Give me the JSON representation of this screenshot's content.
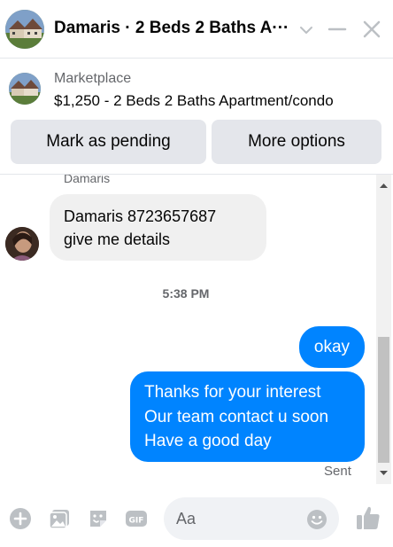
{
  "header": {
    "title": "Damaris · 2 Beds 2 Baths A···",
    "icons": [
      "house-photo-avatar",
      "chevron-down-icon",
      "minimize-icon",
      "close-icon"
    ]
  },
  "listing": {
    "label": "Marketplace",
    "title": "$1,250 - 2 Beds 2 Baths Apartment/condo"
  },
  "actions": {
    "pending_label": "Mark as pending",
    "more_label": "More options"
  },
  "conversation": {
    "sender_name": "Damaris",
    "incoming_lines": [
      "Damaris 8723657687",
      "give me details"
    ],
    "timestamp": "5:38 PM",
    "outgoing": [
      {
        "lines": [
          "okay"
        ]
      },
      {
        "lines": [
          "Thanks for your interest",
          "Our team contact u soon",
          "Have a good day"
        ]
      }
    ],
    "status": "Sent"
  },
  "composer": {
    "placeholder": "Aa",
    "icons": [
      "plus-icon",
      "photo-icon",
      "sticker-icon",
      "gif-icon",
      "emoji-icon",
      "thumbs-up-icon"
    ]
  },
  "colors": {
    "outgoing_bubble": "#0084ff",
    "incoming_bubble": "#f0f0f0",
    "icon_gray": "#bcc0c4",
    "button_bg": "#e4e6eb"
  }
}
